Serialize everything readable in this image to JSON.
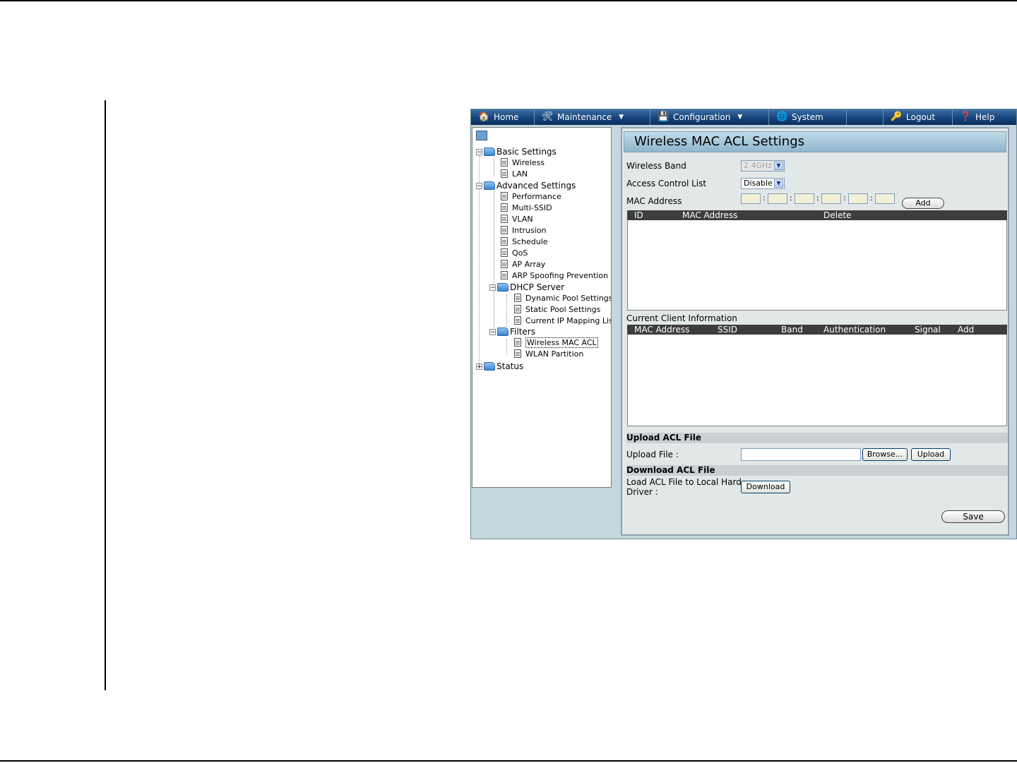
{
  "nav": {
    "home": "Home",
    "maintenance": "Maintenance",
    "configuration": "Configuration",
    "system": "System",
    "logout": "Logout",
    "help": "Help"
  },
  "tree": {
    "basic_settings": "Basic Settings",
    "wireless": "Wireless",
    "lan": "LAN",
    "advanced_settings": "Advanced Settings",
    "performance": "Performance",
    "multi_ssid": "Multi-SSID",
    "vlan": "VLAN",
    "intrusion": "Intrusion",
    "schedule": "Schedule",
    "qos": "QoS",
    "ap_array": "AP Array",
    "arp_spoofing": "ARP Spoofing Prevention",
    "dhcp_server": "DHCP Server",
    "dynamic_pool": "Dynamic Pool Settings",
    "static_pool": "Static Pool Settings",
    "current_ip_mapping": "Current IP Mapping List",
    "filters": "Filters",
    "wireless_mac_acl": "Wireless MAC ACL",
    "wlan_partition": "WLAN Partition",
    "status": "Status"
  },
  "main": {
    "title": "Wireless MAC ACL Settings",
    "wireless_band_label": "Wireless Band",
    "wireless_band_value": "2.4GHz",
    "acl_label": "Access Control List",
    "acl_value": "Disable",
    "mac_label": "MAC Address",
    "mac_sep": ":",
    "add_button": "Add",
    "acl_table": {
      "headers": [
        "ID",
        "MAC Address",
        "Delete"
      ]
    },
    "client_info_label": "Current Client Information",
    "client_table": {
      "headers": [
        "MAC Address",
        "SSID",
        "Band",
        "Authentication",
        "Signal",
        "Add"
      ]
    },
    "upload_section": "Upload ACL File",
    "upload_label": "Upload File :",
    "browse_button": "Browse...",
    "upload_button": "Upload",
    "download_section": "Download ACL File",
    "download_label_1": "Load ACL File to Local Hard",
    "download_label_2": "Driver :",
    "download_button": "Download",
    "save_button": "Save"
  }
}
